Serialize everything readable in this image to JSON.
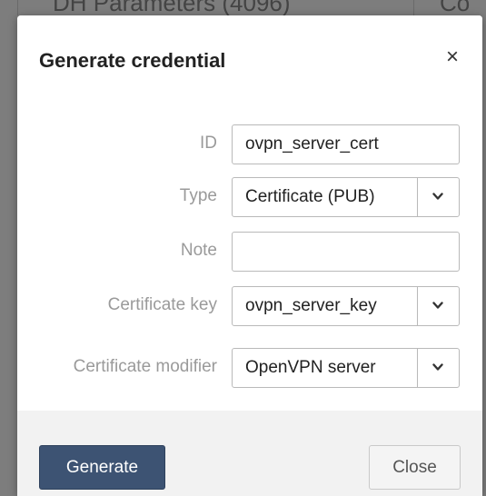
{
  "background": {
    "partial_text_left": "DH Parameters (4096)",
    "partial_text_right": "Co"
  },
  "dialog": {
    "title": "Generate credential",
    "close_glyph": "×",
    "fields": {
      "id": {
        "label": "ID",
        "value": "ovpn_server_cert",
        "placeholder": ""
      },
      "type": {
        "label": "Type",
        "selected": "Certificate (PUB)"
      },
      "note": {
        "label": "Note",
        "value": "",
        "placeholder": ""
      },
      "certificate_key": {
        "label": "Certificate key",
        "selected": "ovpn_server_key"
      },
      "certificate_modifier": {
        "label": "Certificate modifier",
        "selected": "OpenVPN server"
      }
    },
    "buttons": {
      "generate": "Generate",
      "close": "Close"
    }
  },
  "colors": {
    "primary_button": "#3d5373",
    "label_text": "#9a9a9a",
    "footer_bg": "#f2f2f2"
  },
  "icons": {
    "close": "close-icon",
    "dropdown": "chevron-down-icon"
  }
}
